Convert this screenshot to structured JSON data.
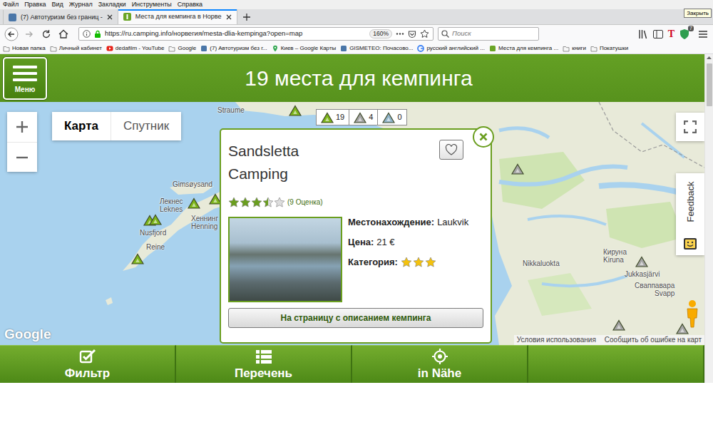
{
  "menubar": [
    "Файл",
    "Правка",
    "Вид",
    "Журнал",
    "Закладки",
    "Инструменты",
    "Справка"
  ],
  "tooltip": "Закрыть",
  "tabs": [
    {
      "label": "(7) Автотуризм без границ - ",
      "selected": false
    },
    {
      "label": "Места для кемпинга в Норве",
      "selected": true
    }
  ],
  "address": {
    "url": "https://ru.camping.info/норвегия/mesta-dlia-kempinga?open=map",
    "zoom": "160%"
  },
  "search": {
    "placeholder": "Поиск"
  },
  "extension_letter": "T",
  "toolbar_badge": "7",
  "bookmarks": [
    {
      "label": "Новая папка",
      "kind": "folder"
    },
    {
      "label": "Личный кабинет",
      "kind": "folder"
    },
    {
      "label": "dedafilm - YouTube",
      "kind": "youtube"
    },
    {
      "label": "Google",
      "kind": "folder"
    },
    {
      "label": "(7) Автотуризм без г...",
      "kind": "site"
    },
    {
      "label": "Киев – Google Карты",
      "kind": "maps"
    },
    {
      "label": "GISMETEO: Почасово...",
      "kind": "site"
    },
    {
      "label": "русский английский ...",
      "kind": "google"
    },
    {
      "label": "Места для кемпинга ...",
      "kind": "camping"
    },
    {
      "label": "книги",
      "kind": "folder"
    },
    {
      "label": "Покатушки",
      "kind": "folder"
    }
  ],
  "header": {
    "menu_label": "Меню",
    "title": "19 места для кемпинга"
  },
  "map": {
    "view_tabs": [
      {
        "label": "Карта",
        "selected": true
      },
      {
        "label": "Спутник",
        "selected": false
      }
    ],
    "counters": [
      {
        "count": "19",
        "color": "#7cb518"
      },
      {
        "count": "4",
        "color": "#a3a3a3"
      },
      {
        "count": "0",
        "color": "#8fb3c9"
      }
    ],
    "pins": [
      {
        "color": "#7cb518"
      },
      {
        "color": "#7cb518"
      },
      {
        "color": "#7cb518"
      },
      {
        "color": "#7cb518"
      },
      {
        "color": "#7cb518"
      },
      {
        "color": "#7cb518"
      },
      {
        "color": "#a3a3a3"
      },
      {
        "color": "#a3a3a3"
      },
      {
        "color": "#a3a3a3"
      },
      {
        "color": "#a3a3a3"
      }
    ],
    "labels": [
      "Straume",
      "Gimsøysand",
      "Лекнес",
      "Leknes",
      "Nusfjord",
      "Reine",
      "Хеннинг",
      "Henning",
      "Nikkaluokta",
      "Кируна",
      "Kiruna",
      "Jukkasjärvi",
      "Сваппавара",
      "Svapp"
    ],
    "feedback": "Feedback",
    "attribution": {
      "logo": "Google",
      "terms": "Условия использования",
      "report": "Сообщить об ошибке на карт"
    }
  },
  "popup": {
    "title": "Sandsletta Camping",
    "favorite": false,
    "stars": 3.5,
    "rating": "(9 Оценка)",
    "location_label": "Местонахождение:",
    "location": "Laukvik",
    "price_label": "Цена:",
    "price": "21 €",
    "category_label": "Категория:",
    "category_stars": 3,
    "button": "На страницу с описанием кемпинга"
  },
  "bottom_nav": [
    {
      "label": "Фильтр"
    },
    {
      "label": "Перечень"
    },
    {
      "label": "in Nähe"
    }
  ]
}
